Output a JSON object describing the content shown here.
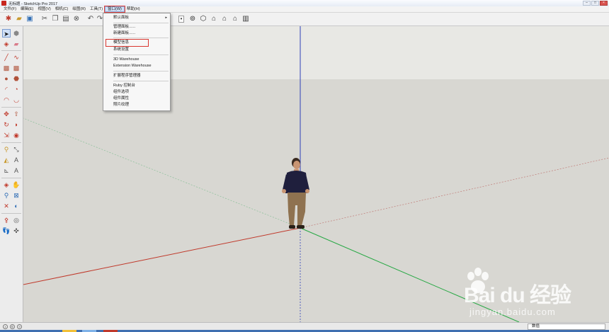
{
  "window": {
    "title": "无标题 - SketchUp Pro 2017",
    "controls": [
      "minimize",
      "maximize",
      "close"
    ]
  },
  "menubar": {
    "items": [
      {
        "label": "文件(F)"
      },
      {
        "label": "编辑(E)"
      },
      {
        "label": "视图(V)"
      },
      {
        "label": "相机(C)"
      },
      {
        "label": "绘图(R)"
      },
      {
        "label": "工具(T)"
      },
      {
        "label": "窗口(W)",
        "active": true
      },
      {
        "label": "帮助(H)"
      }
    ]
  },
  "window_menu": {
    "items": [
      {
        "label": "默认面板",
        "submenu": true
      },
      {
        "label": "管理面板......"
      },
      {
        "label": "新建面板......"
      },
      {
        "label": "模型信息",
        "highlighted": true
      },
      {
        "label": "系统设置"
      },
      {
        "label": "3D Warehouse"
      },
      {
        "label": "Extension Warehouse"
      },
      {
        "label": "扩展程序管理器"
      },
      {
        "label": "Ruby 控制台"
      },
      {
        "label": "组件选项"
      },
      {
        "label": "组件属性"
      },
      {
        "label": "照片纹理"
      }
    ]
  },
  "toolbar": {
    "icons": [
      "new-icon",
      "open-icon",
      "save-icon",
      "cut-icon",
      "copy-icon",
      "paste-icon",
      "erase-icon",
      "undo-icon",
      "redo-icon",
      "print-icon",
      "orbit-icon",
      "iso-view-icon",
      "top-view-icon",
      "front-view-icon",
      "right-view-icon",
      "back-view-icon",
      "left-view-icon"
    ]
  },
  "palette": {
    "icons": [
      "select-icon",
      "make-component-icon",
      "paint-bucket-icon",
      "eraser-icon",
      "line-icon",
      "freehand-icon",
      "rectangle-icon",
      "rotated-rectangle-icon",
      "circle-icon",
      "polygon-icon",
      "arc-icon",
      "pie-icon",
      "two-point-arc-icon",
      "three-point-arc-icon",
      "move-icon",
      "push-pull-icon",
      "rotate-icon",
      "follow-me-icon",
      "scale-icon",
      "offset-icon",
      "tape-measure-icon",
      "dimension-icon",
      "protractor-icon",
      "text-icon",
      "axes-icon",
      "3d-text-icon",
      "orbit-icon",
      "pan-icon",
      "zoom-icon",
      "zoom-window-icon",
      "zoom-extents-icon",
      "previous-icon",
      "position-camera-icon",
      "walk-icon",
      "look-around-icon",
      "section-plane-icon"
    ]
  },
  "statusbar": {
    "measurements_label": "数值",
    "value": ""
  },
  "watermark": {
    "brand": "Bai du 经验",
    "url": "jingyan.baidu.com"
  },
  "colors": {
    "sky": "#e7e7e3",
    "ground": "#d8d7d2",
    "axis_red": "#c0392b",
    "axis_green": "#27a844",
    "axis_blue": "#2e3fb8",
    "highlight_box": "#d9362f"
  }
}
